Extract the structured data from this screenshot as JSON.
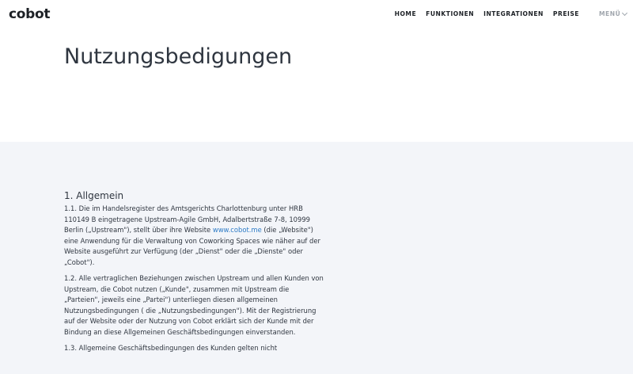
{
  "header": {
    "logo": "cobot",
    "nav": [
      "HOME",
      "FUNKTIONEN",
      "INTEGRATIONEN",
      "PREISE"
    ],
    "menu_label": "MENÜ",
    "menu_icon": "chevron-down-icon"
  },
  "hero": {
    "title": "Nutzungsbedigungen"
  },
  "content": {
    "section_heading": "1. Allgemein",
    "p1": {
      "before": "1.1. Die im Handelsregister des Amtsgerichts Charlottenburg unter HRB 110149 B eingetragene Upstream-Agile GmbH, Adalbertstraße 7-8, 10999 Berlin („Upstream\"), stellt über ihre Website ",
      "link": "www.cobot.me",
      "after": " (die „Website\") eine Anwendung für die Verwaltung von Coworking Spaces wie näher auf der Website ausgeführt zur Verfügung (der „Dienst\" oder die „Dienste\" oder „Cobot\")."
    },
    "p2": "1.2. Alle vertraglichen Beziehungen zwischen Upstream und allen Kunden von Upstream, die Cobot nutzen („Kunde\", zusammen mit Upstream die „Parteien\", jeweils eine „Partei\") unterliegen diesen allgemeinen Nutzungsbedingungen ( die „Nutzungsbedingungen\"). Mit der Registrierung auf der Website oder der Nutzung von Cobot erklärt sich der Kunde mit der Bindung an diese Allgemeinen Geschäftsbedingungen einverstanden.",
    "p3": "1.3. Allgemeine Geschäftsbedingungen des Kunden gelten nicht"
  },
  "colors": {
    "text": "#2f3640",
    "link": "#2d7bc6",
    "content_bg": "#f3f5f9",
    "menu": "#a0a6ad"
  }
}
